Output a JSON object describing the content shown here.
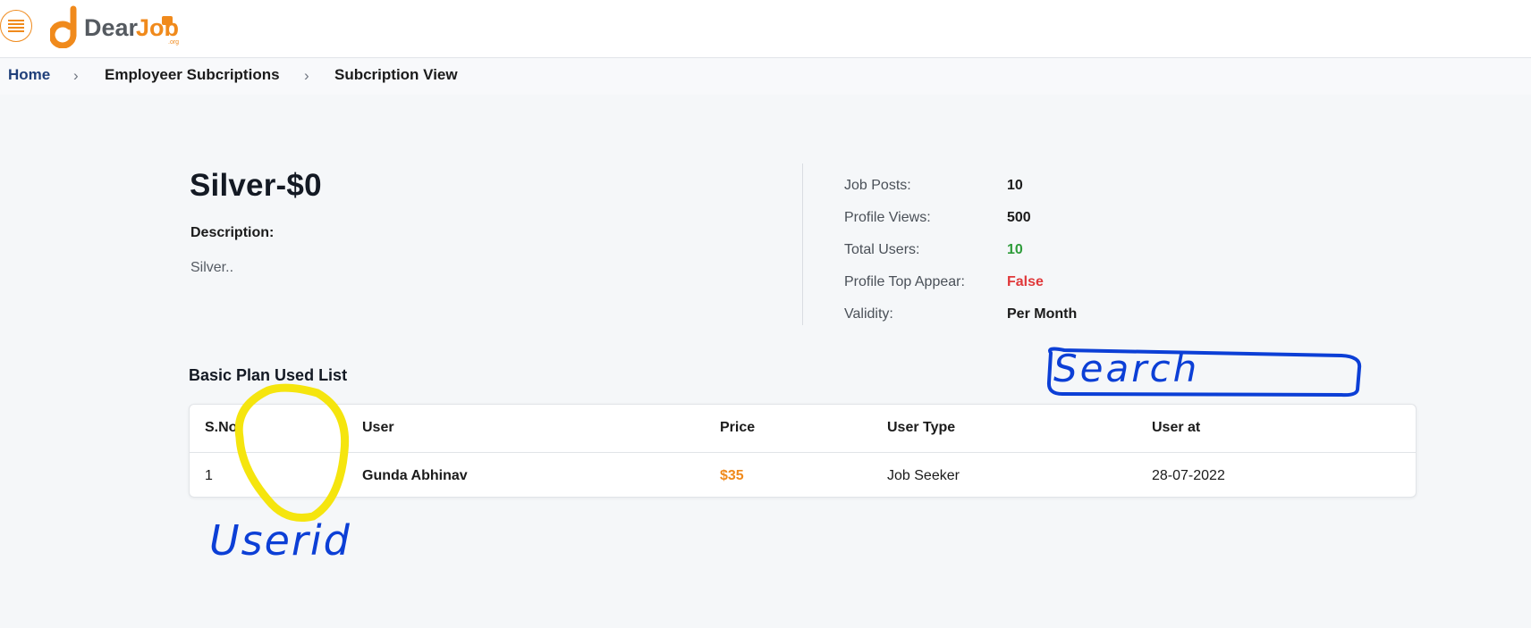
{
  "header": {
    "menu_icon": "hamburger-menu-icon",
    "logo_text": "DearJob",
    "logo_subtext": ".org",
    "brand_color": "#f08a1c"
  },
  "breadcrumb": {
    "home": "Home",
    "section": "Employeer Subcriptions",
    "current": "Subcription View",
    "separator_icon": "chevron-right-icon"
  },
  "plan": {
    "title": "Silver-$0",
    "description_label": "Description:",
    "description_value": "Silver.."
  },
  "stats": [
    {
      "label": "Job Posts:",
      "value": "10",
      "color": "#1b1b1b"
    },
    {
      "label": "Profile Views:",
      "value": "500",
      "color": "#1b1b1b"
    },
    {
      "label": "Total Users:",
      "value": "10",
      "color": "#2e9c3a"
    },
    {
      "label": "Profile Top Appear:",
      "value": "False",
      "color": "#e0393b"
    },
    {
      "label": "Validity:",
      "value": "Per Month",
      "color": "#1b1b1b"
    }
  ],
  "list": {
    "title": "Basic Plan Used List",
    "columns": [
      "S.No",
      "User",
      "Price",
      "User Type",
      "User at"
    ],
    "rows": [
      {
        "sno": "1",
        "user": "Gunda Abhinav",
        "price": "$35",
        "user_type": "Job Seeker",
        "user_at": "28-07-2022"
      }
    ]
  },
  "annotations": {
    "search_note": "Search",
    "userid_note": "Userid",
    "pen_color": "#0c3fd6",
    "highlight_color": "#f5e50e"
  }
}
